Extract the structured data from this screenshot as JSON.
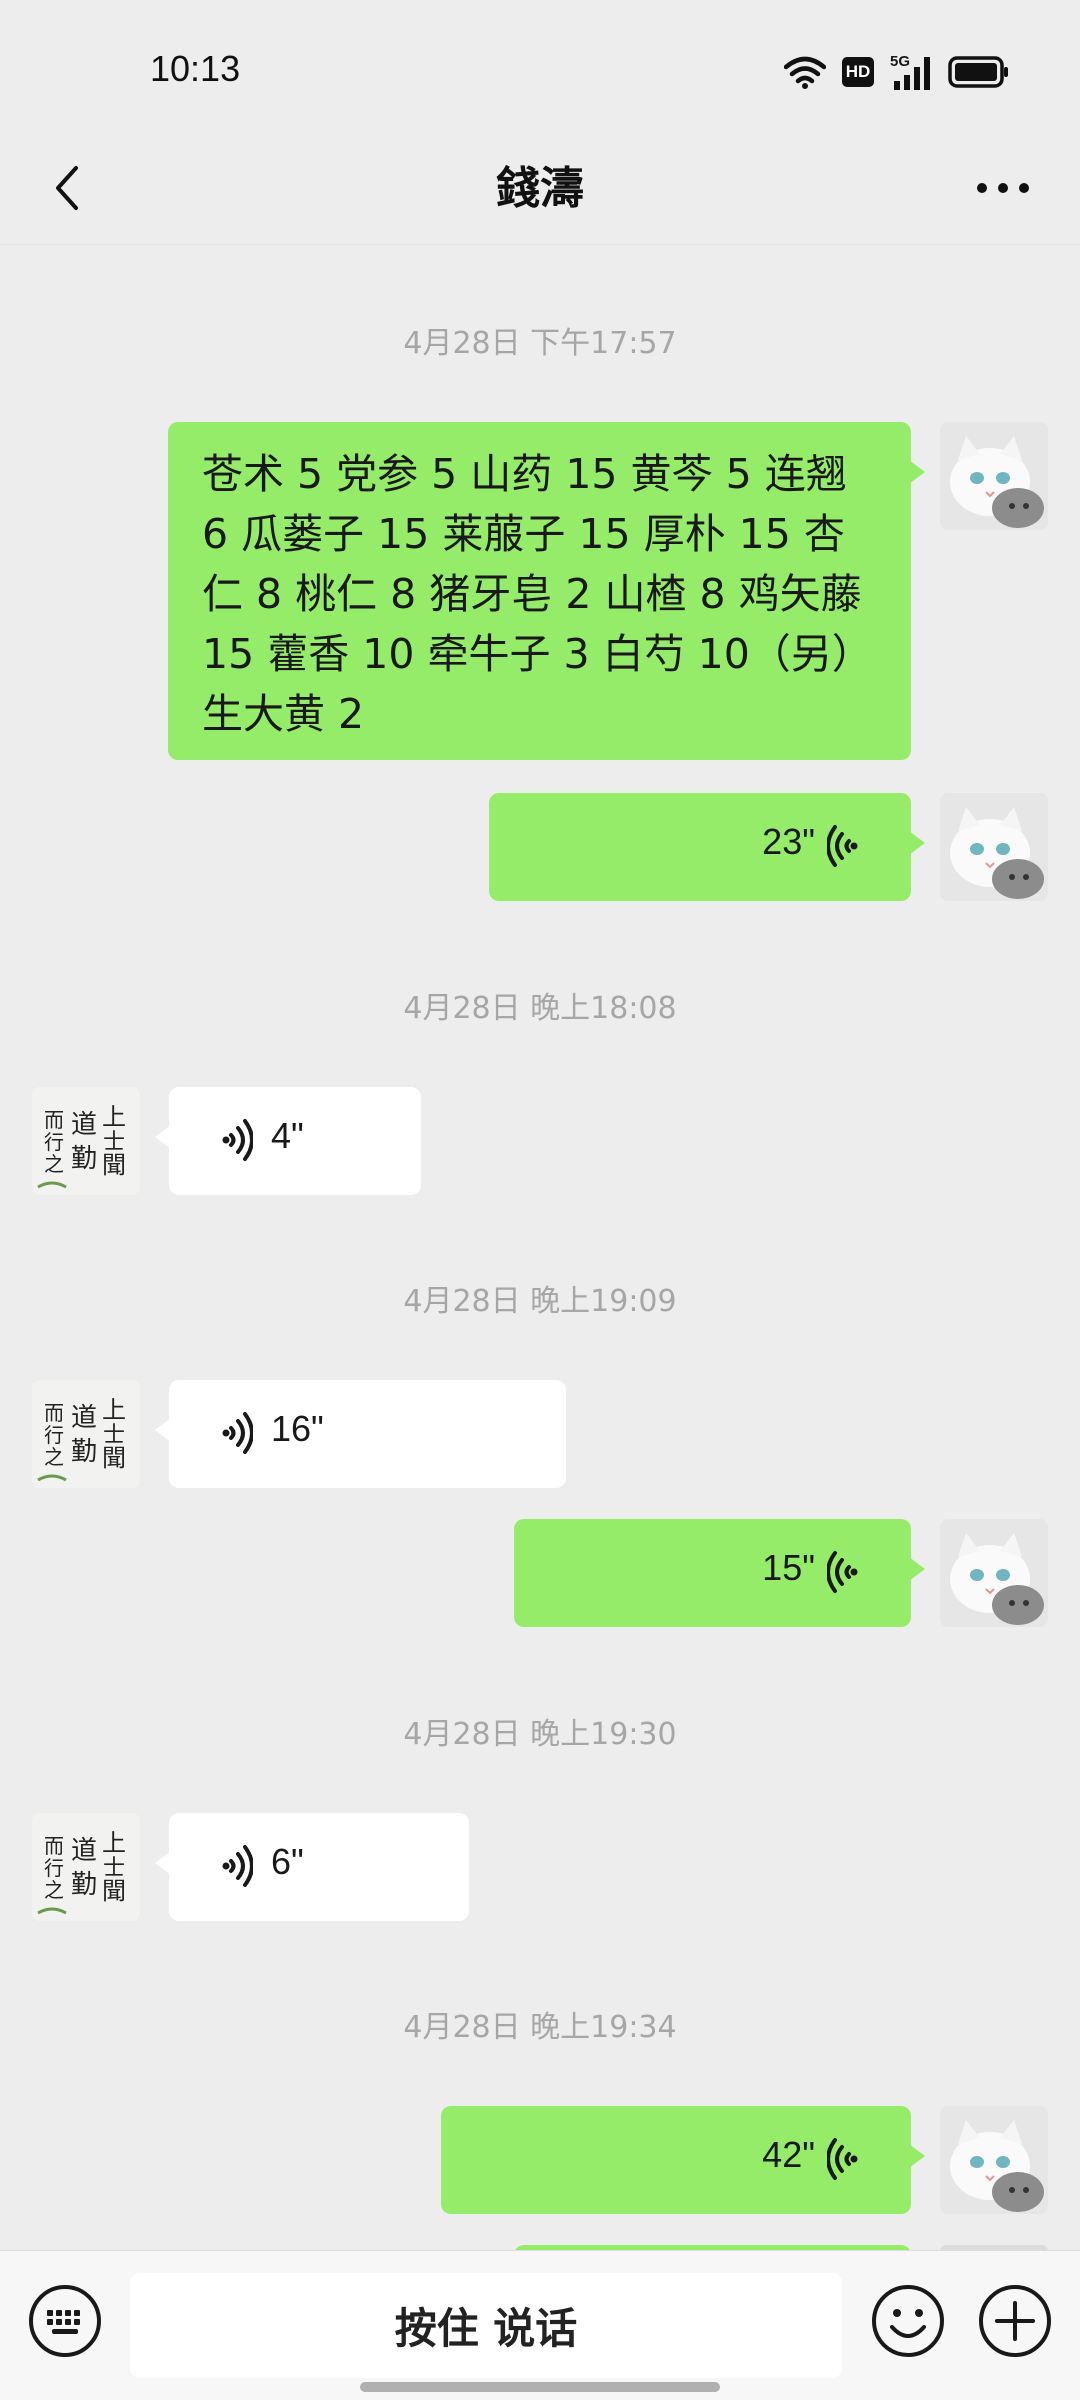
{
  "status_bar": {
    "time": "10:13",
    "hd": "HD",
    "network": "5G"
  },
  "header": {
    "title": "錢濤"
  },
  "messages": [
    {
      "kind": "time",
      "text": "4月28日 下午17:57"
    },
    {
      "kind": "text",
      "dir": "out",
      "text": "苍术 5 党参 5 山药 15 黄芩 5 连翘 6 瓜蒌子 15 莱菔子 15 厚朴 15 杏仁 8 桃仁 8 猪牙皂 2 山楂 8 鸡矢藤 15 藿香 10 牵牛子 3 白芍 10（另）生大黄 2"
    },
    {
      "kind": "voice",
      "dir": "out",
      "duration": "23\""
    },
    {
      "kind": "time",
      "text": "4月28日 晚上18:08"
    },
    {
      "kind": "voice",
      "dir": "in",
      "duration": "4\""
    },
    {
      "kind": "time",
      "text": "4月28日 晚上19:09"
    },
    {
      "kind": "voice",
      "dir": "in",
      "duration": "16\""
    },
    {
      "kind": "voice",
      "dir": "out",
      "duration": "15\""
    },
    {
      "kind": "time",
      "text": "4月28日 晚上19:30"
    },
    {
      "kind": "voice",
      "dir": "in",
      "duration": "6\""
    },
    {
      "kind": "time",
      "text": "4月28日 晚上19:34"
    },
    {
      "kind": "voice",
      "dir": "out",
      "duration": "42\""
    }
  ],
  "contact_avatar_text": "上士聞道勤而行之",
  "input_bar": {
    "hold_to_talk": "按住 说话"
  },
  "colors": {
    "outgoing_bubble": "#95ec69",
    "incoming_bubble": "#ffffff",
    "background": "#ededed"
  }
}
